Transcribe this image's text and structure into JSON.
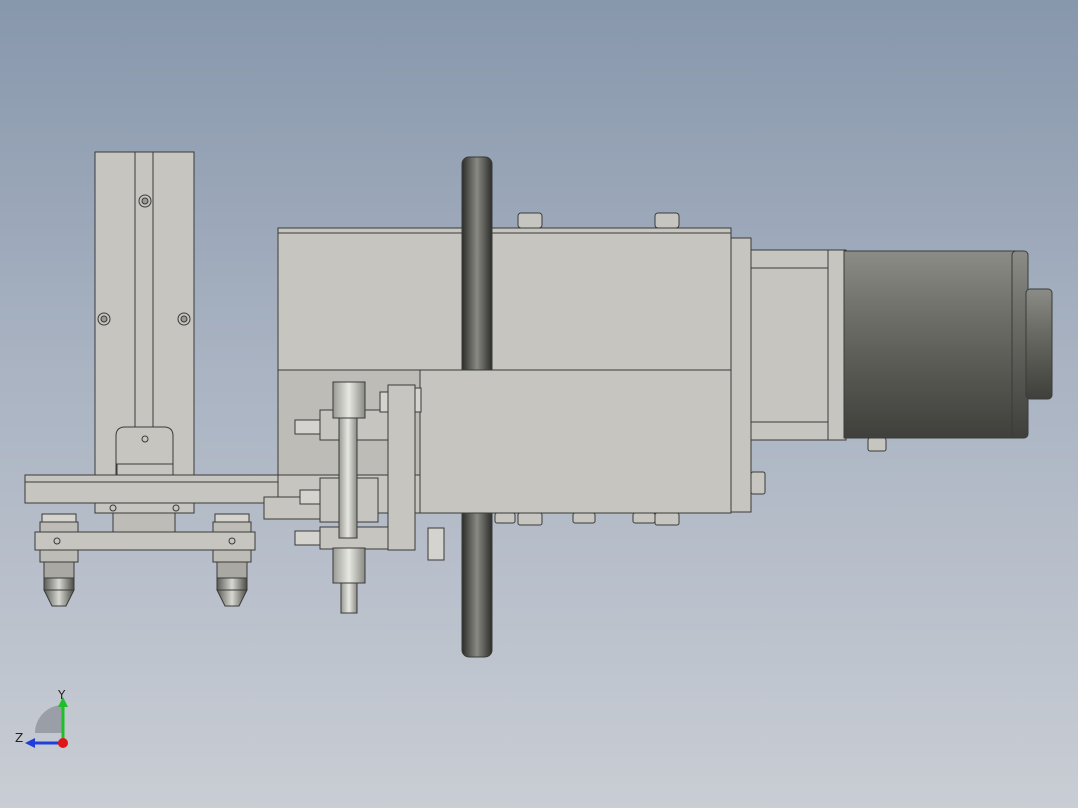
{
  "triad": {
    "y_label": "Y",
    "z_label": "Z"
  },
  "colors": {
    "bg_top": "#8797ac",
    "bg_bottom": "#c9cdd4",
    "part_face": "#c6c5bf",
    "part_edge": "#3a3a3a",
    "motor_dark": "#5a5a56",
    "y_axis": "#1fbf2a",
    "x_axis": "#e01515",
    "z_axis": "#1f3fd8"
  }
}
